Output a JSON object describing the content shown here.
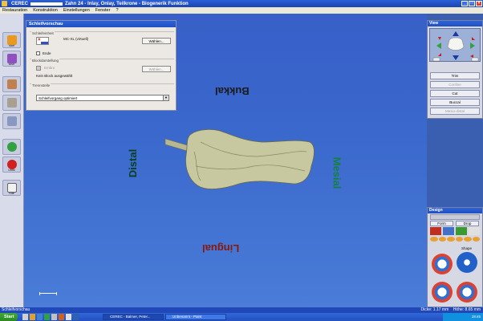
{
  "window": {
    "app": "CEREC",
    "title_rest": "Zahn 24 - Inlay, Onlay, Teilkrone - Biogenerik Funktion"
  },
  "menu": [
    "Restauration",
    "Konstruktion",
    "Einstellungen",
    "Fenster",
    "?"
  ],
  "toolbar": [
    {
      "label": "start"
    },
    {
      "label": "save"
    },
    {
      "label": ""
    },
    {
      "label": ""
    },
    {
      "label": ""
    },
    {
      "label": ""
    },
    {
      "label": "Undo"
    },
    {
      "label": "Edit"
    }
  ],
  "grinding_panel": {
    "title": "Schleifvorschau",
    "group1_label": "Schleifeinheit",
    "unit_name": "MC-XL (virtuell)",
    "button_select": "Wählen...",
    "checkbox_end_label": "Ende",
    "group2_label": "Blockdarstellung",
    "block_dropdown": "Embro",
    "block_button": "Wählen...",
    "no_block_text": "Kein Block ausgewählt",
    "group3_label": "Trennstelle",
    "grinding_select": "Schleifvorgang optimiert"
  },
  "labels3d": {
    "bukkal": "Bukkal",
    "distal": "Distal",
    "mesial": "Mesial",
    "lingual": "Lingual"
  },
  "view_panel": {
    "title": "View",
    "buttons": [
      {
        "label": "Trim",
        "disabled": false
      },
      {
        "label": "Confine",
        "disabled": true
      },
      {
        "label": "Cut",
        "disabled": false
      },
      {
        "label": "Buccal",
        "disabled": false
      },
      {
        "label": "Mesio-distal",
        "disabled": true
      }
    ]
  },
  "design_panel": {
    "title": "Design",
    "tabs": [
      "Form",
      "Drop"
    ],
    "shape_label": "Shape"
  },
  "statusbar": {
    "left": "Schleifvorschau",
    "dicke_label": "Dicke:",
    "dicke_value": "1.17 mm",
    "hoehe_label": "Höhe:",
    "hoehe_value": "8.65 mm"
  },
  "taskbar": {
    "start": "Start",
    "tasks": [
      "CEREC - Balmer, Peter...",
      "Unbenannt - Paint"
    ],
    "clock": "19:45"
  },
  "colors": {
    "viewport": "#3a68cc",
    "titlebar": "#2a5fd8",
    "bukkal": "#1a1a1a",
    "distal": "#0a4020",
    "mesial": "#148040",
    "lingual": "#8a1808",
    "model": "#c8c8a0"
  }
}
